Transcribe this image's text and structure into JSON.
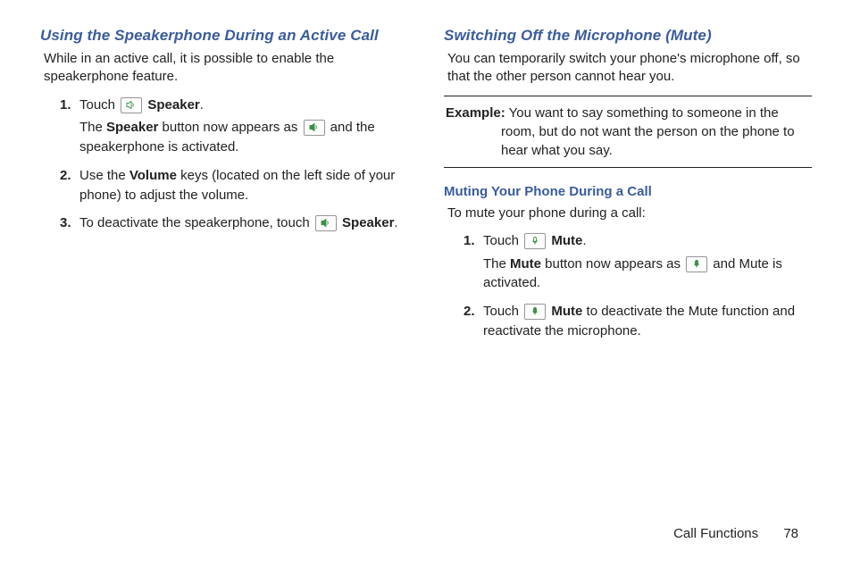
{
  "left": {
    "title": "Using the Speakerphone During an Active Call",
    "intro": "While in an active call, it is possible to enable the speakerphone feature.",
    "steps": {
      "s1": {
        "num": "1.",
        "a": "Touch ",
        "icon1_name": "speaker-off-icon",
        "b": " Speaker",
        "c": ".",
        "cont_a": "The ",
        "cont_b": "Speaker",
        "cont_c": " button now appears as ",
        "icon2_name": "speaker-on-icon",
        "cont_d": " and the speakerphone is activated."
      },
      "s2": {
        "num": "2.",
        "a": "Use the ",
        "b": "Volume",
        "c": " keys (located on the left side of your phone) to adjust the volume."
      },
      "s3": {
        "num": "3.",
        "a": "To deactivate the speakerphone, touch ",
        "icon_name": "speaker-on-icon",
        "b": " Speaker",
        "c": "."
      }
    }
  },
  "right": {
    "title": "Switching Off the Microphone (Mute)",
    "intro": "You can temporarily switch your phone's microphone off, so that the other person cannot hear you.",
    "example": {
      "label": "Example:",
      "text_l1": " You want to say something to someone in the",
      "text_l2": "room, but do not want the person on the phone to hear what you say."
    },
    "subtitle": "Muting Your Phone During a Call",
    "subintro": "To mute your phone during a call:",
    "steps": {
      "s1": {
        "num": "1.",
        "a": "Touch ",
        "icon1_name": "mute-off-icon",
        "b": " Mute",
        "c": ".",
        "cont_a": "The ",
        "cont_b": "Mute",
        "cont_c": " button now appears as ",
        "icon2_name": "mute-on-icon",
        "cont_d": " and Mute is activated."
      },
      "s2": {
        "num": "2.",
        "a": "Touch ",
        "icon_name": "mute-on-icon",
        "b": " Mute",
        "c": " to deactivate the Mute function and reactivate the microphone."
      }
    }
  },
  "footer": {
    "section": "Call Functions",
    "page": "78"
  }
}
